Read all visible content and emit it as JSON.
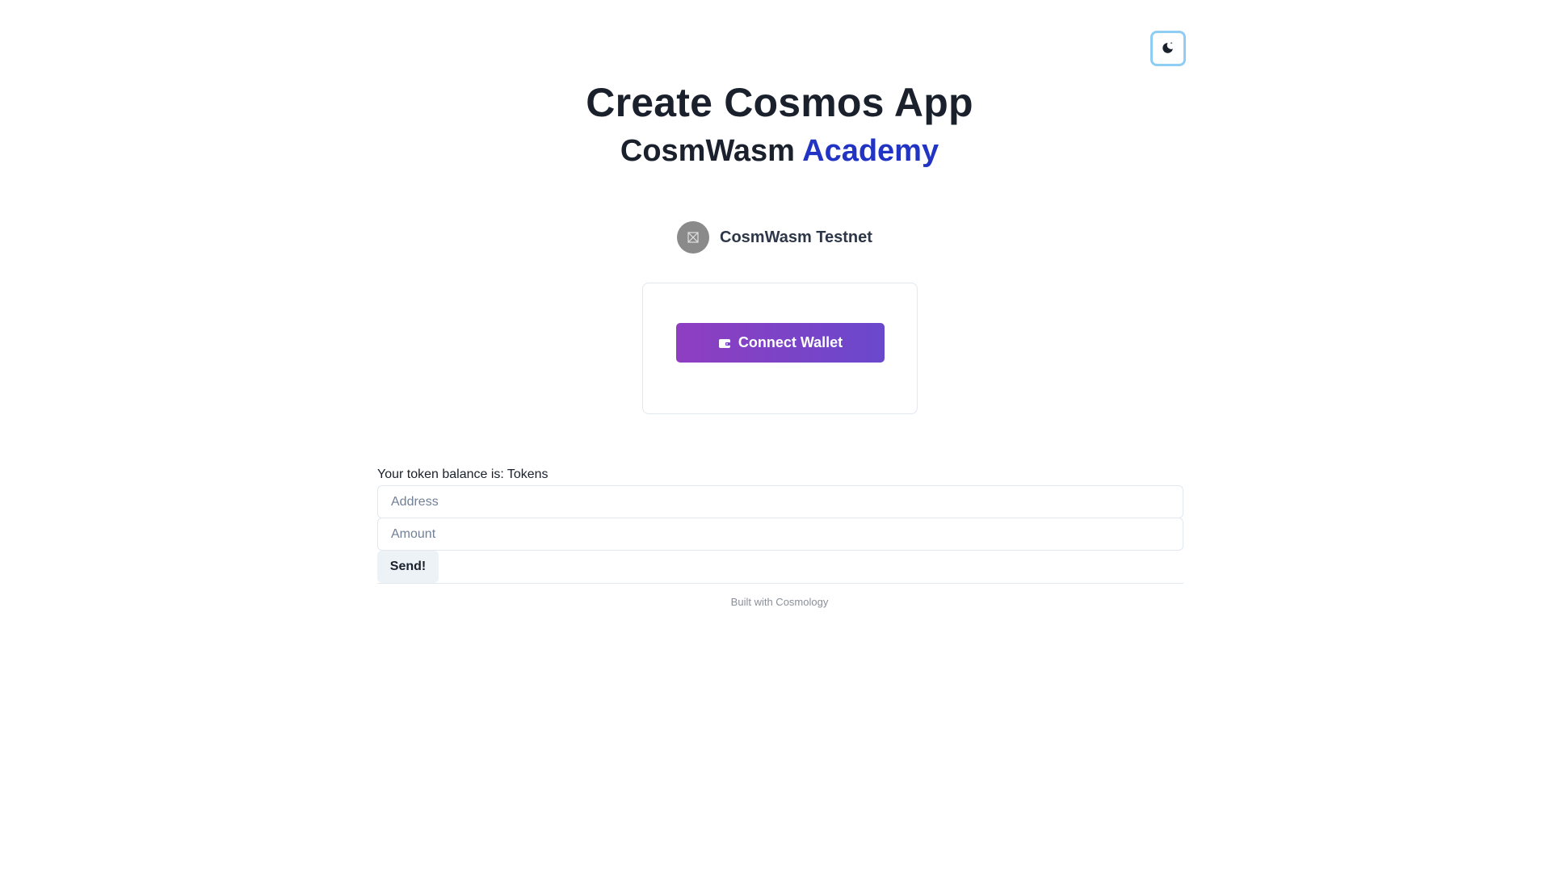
{
  "theme_toggle": {
    "icon": "moon-icon"
  },
  "header": {
    "title": "Create Cosmos App",
    "subtitle_main": "CosmWasm",
    "subtitle_accent": "Academy",
    "accent_color": "#2234c4"
  },
  "chain": {
    "name": "CosmWasm Testnet",
    "avatar_icon": "broken-image-icon"
  },
  "wallet": {
    "connect_label": "Connect Wallet",
    "icon": "wallet-icon",
    "gradient": [
      "#8f3ec1",
      "#6a48cc"
    ]
  },
  "balance": {
    "label": "Your token balance is:",
    "unit": "Tokens"
  },
  "form": {
    "address_placeholder": "Address",
    "amount_placeholder": "Amount",
    "send_label": "Send!"
  },
  "footer": {
    "text": "Built with Cosmology"
  }
}
